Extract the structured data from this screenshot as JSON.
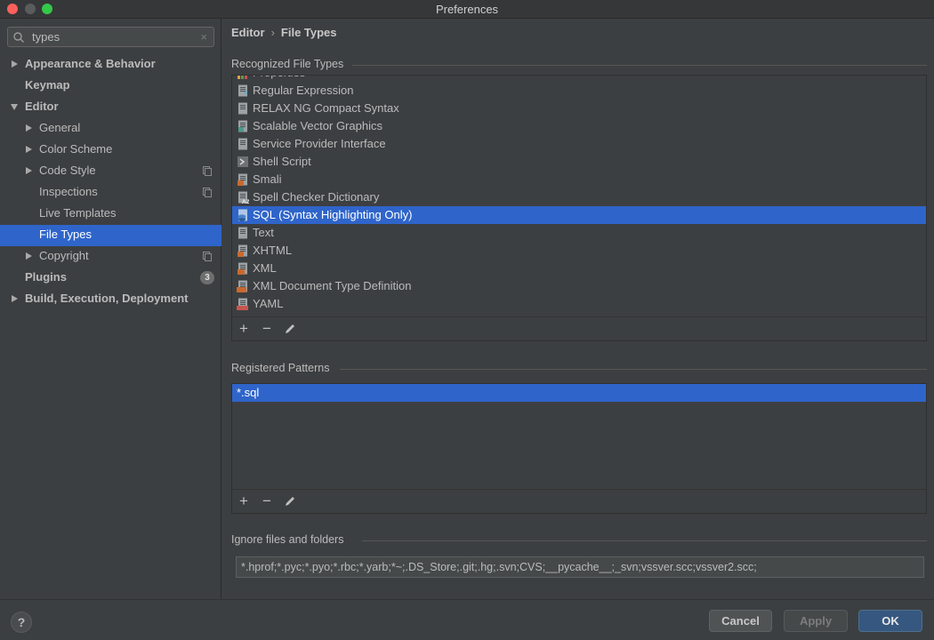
{
  "window": {
    "title": "Preferences"
  },
  "search": {
    "value": "types",
    "clear": "×"
  },
  "sidebar": {
    "items": [
      {
        "label": "Appearance & Behavior",
        "level": 0,
        "arrow": "right"
      },
      {
        "label": "Keymap",
        "level": 0
      },
      {
        "label": "Editor",
        "level": 0,
        "arrow": "down"
      },
      {
        "label": "General",
        "level": 1,
        "arrow": "right"
      },
      {
        "label": "Color Scheme",
        "level": 1,
        "arrow": "right"
      },
      {
        "label": "Code Style",
        "level": 1,
        "arrow": "right",
        "copy": true
      },
      {
        "label": "Inspections",
        "level": 1,
        "copy": true
      },
      {
        "label": "Live Templates",
        "level": 1
      },
      {
        "label": "File Types",
        "level": 1,
        "selected": true
      },
      {
        "label": "Copyright",
        "level": 1,
        "arrow": "right",
        "copy": true
      },
      {
        "label": "Plugins",
        "level": 0,
        "badge": "3"
      },
      {
        "label": "Build, Execution, Deployment",
        "level": 0,
        "arrow": "right"
      }
    ]
  },
  "breadcrumb": {
    "parent": "Editor",
    "separator": "›",
    "current": "File Types"
  },
  "recognized": {
    "title": "Recognized File Types",
    "items": [
      {
        "label": "Properties",
        "icon": "properties-file-icon"
      },
      {
        "label": "Regular Expression",
        "icon": "regex-file-icon"
      },
      {
        "label": "RELAX NG Compact Syntax",
        "icon": "text-file-icon"
      },
      {
        "label": "Scalable Vector Graphics",
        "icon": "svg-file-icon"
      },
      {
        "label": "Service Provider Interface",
        "icon": "text-file-icon"
      },
      {
        "label": "Shell Script",
        "icon": "shell-file-icon"
      },
      {
        "label": "Smali",
        "icon": "smali-file-icon"
      },
      {
        "label": "Spell Checker Dictionary",
        "icon": "dictionary-file-icon"
      },
      {
        "label": "SQL (Syntax Highlighting Only)",
        "icon": "sql-file-icon",
        "selected": true
      },
      {
        "label": "Text",
        "icon": "text-file-icon"
      },
      {
        "label": "XHTML",
        "icon": "xhtml-file-icon"
      },
      {
        "label": "XML",
        "icon": "xml-file-icon"
      },
      {
        "label": "XML Document Type Definition",
        "icon": "dtd-file-icon"
      },
      {
        "label": "YAML",
        "icon": "yaml-file-icon"
      }
    ],
    "toolbar": {
      "add": "+",
      "remove": "−"
    }
  },
  "patterns": {
    "title": "Registered Patterns",
    "items": [
      "*.sql"
    ],
    "toolbar": {
      "add": "+",
      "remove": "−"
    }
  },
  "ignore": {
    "title": "Ignore files and folders",
    "value": "*.hprof;*.pyc;*.pyo;*.rbc;*.yarb;*~;.DS_Store;.git;.hg;.svn;CVS;__pycache__;_svn;vssver.scc;vssver2.scc;"
  },
  "buttons": {
    "help": "?",
    "cancel": "Cancel",
    "apply": "Apply",
    "ok": "OK"
  },
  "colors": {
    "selection": "#2f65ca",
    "background": "#3c3f41",
    "ok_button": "#365880"
  }
}
